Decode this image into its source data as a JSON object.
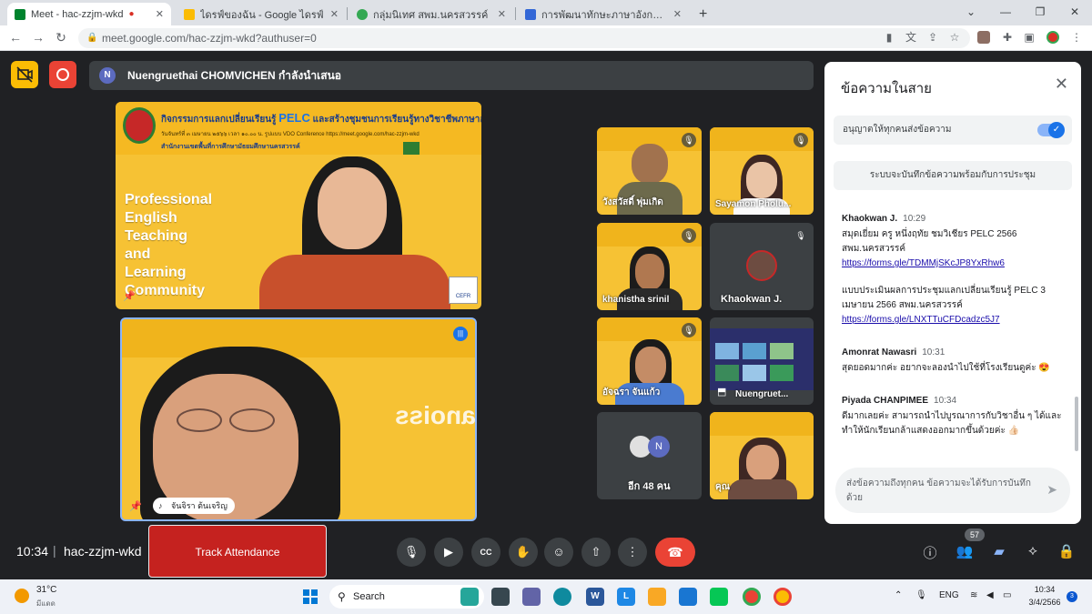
{
  "browser": {
    "tabs": [
      {
        "label": "Meet - hac-zzjm-wkd",
        "favicon_color": "#00832d"
      },
      {
        "label": "ไดรฟ์ของฉัน - Google ไดรฟ์",
        "favicon_color": "#fbbc04"
      },
      {
        "label": "กลุ่มนิเทศ สพม.นครสวรรค์",
        "favicon_color": "#34a853"
      },
      {
        "label": "การพัฒนาทักษะภาษาอังกฤษ English",
        "favicon_color": "#3367d6"
      }
    ],
    "new_tab": "+",
    "url": "meet.google.com/hac-zzjm-wkd?authuser=0"
  },
  "meet": {
    "presenter_initial": "N",
    "presenter_text": "Nuengruethai CHOMVICHEN กำลังนำเสนอ",
    "main_slide": {
      "title_pre": "กิจกรรมการแลกเปลี่ยนเรียนรู้",
      "title_pelc": "PELC",
      "title_post": "และสร้างชุมชนการเรียนรู้ทางวิชาชีพภาษาอังกฤษ",
      "subtitle": "วันจันทร์ที่ ๓ เมษายน ๒๕๖๖ เวลา ๑๐.๐๐ น. รูปแบบ VDO Conference https://meet.google.com/hac-zzjm-wkd",
      "office": "สำนักงานเขตพื้นที่การศึกษามัธยมศึกษานครสวรรค์",
      "words": [
        "Professional",
        "English",
        "Teaching",
        "and",
        "Learning",
        "Community"
      ],
      "cefr": "CEFR"
    },
    "self_name": "จันจิรา ต้นเจริญ",
    "participants": [
      {
        "name": "วังสวัสดิ์ พุ่มเกิด"
      },
      {
        "name": "Sayamon Pholu..."
      },
      {
        "name": "khanistha srinil"
      },
      {
        "name": "Khaokwan J."
      },
      {
        "name": "อัจฉรา จันแก้ว"
      },
      {
        "name": "Nuengruet..."
      },
      {
        "name": "อีก 48 คน"
      },
      {
        "name": "คุณ"
      }
    ],
    "others_avatar_initial": "N"
  },
  "chat": {
    "title": "ข้อความในสาย",
    "allow_label": "อนุญาตให้ทุกคนส่งข้อความ",
    "save_note": "ระบบจะบันทึกข้อความพร้อมกับการประชุม",
    "messages": [
      {
        "sender": "Khaokwan J.",
        "time": "10:29",
        "text": "สมุดเยี่ยม ครู หนึ่งฤทัย ชมวิเชียร PELC 2566 สพม.นครสวรรค์",
        "link1": "https://forms.gle/TDMMjSKcJP8YxRhw6",
        "text2": "แบบประเมินผลการประชุมแลกเปลี่ยนเรียนรู้ PELC 3 เมษายน 2566 สพม.นครสวรรค์",
        "link2": "https://forms.gle/LNXTTuCFDcadzc5J7"
      },
      {
        "sender": "Amonrat Nawasri",
        "time": "10:31",
        "text": "สุดยอดมากค่ะ อยากจะลองนำไปใช้ที่โรงเรียนดูค่ะ 😍"
      },
      {
        "sender": "Piyada CHANPIMEE",
        "time": "10:34",
        "text": "ดีมากเลยค่ะ สามารถนำไปบูรณาการกับวิชาอื่น ๆ ได้และทำให้นักเรียนกล้าแสดงออกมากขึ้นด้วยค่ะ 👍🏻"
      }
    ],
    "input_placeholder": "ส่งข้อความถึงทุกคน ข้อความจะได้รับการบันทึกด้วย"
  },
  "bottom": {
    "time": "10:34",
    "separator": "|",
    "meeting_code": "hac-zzjm-wkd",
    "track_attendance": "Track Attendance",
    "people_count": "57"
  },
  "taskbar": {
    "temp": "31°C",
    "weather": "มีแดด",
    "search": "Search",
    "lang": "ENG",
    "time": "10:34",
    "date": "3/4/2566",
    "notif": "3"
  },
  "colors": {
    "meet_bg": "#202124",
    "slide_yellow": "#f6c234",
    "end_call": "#ea4335",
    "track_btn": "#c5221f",
    "link": "#1a0dab"
  }
}
